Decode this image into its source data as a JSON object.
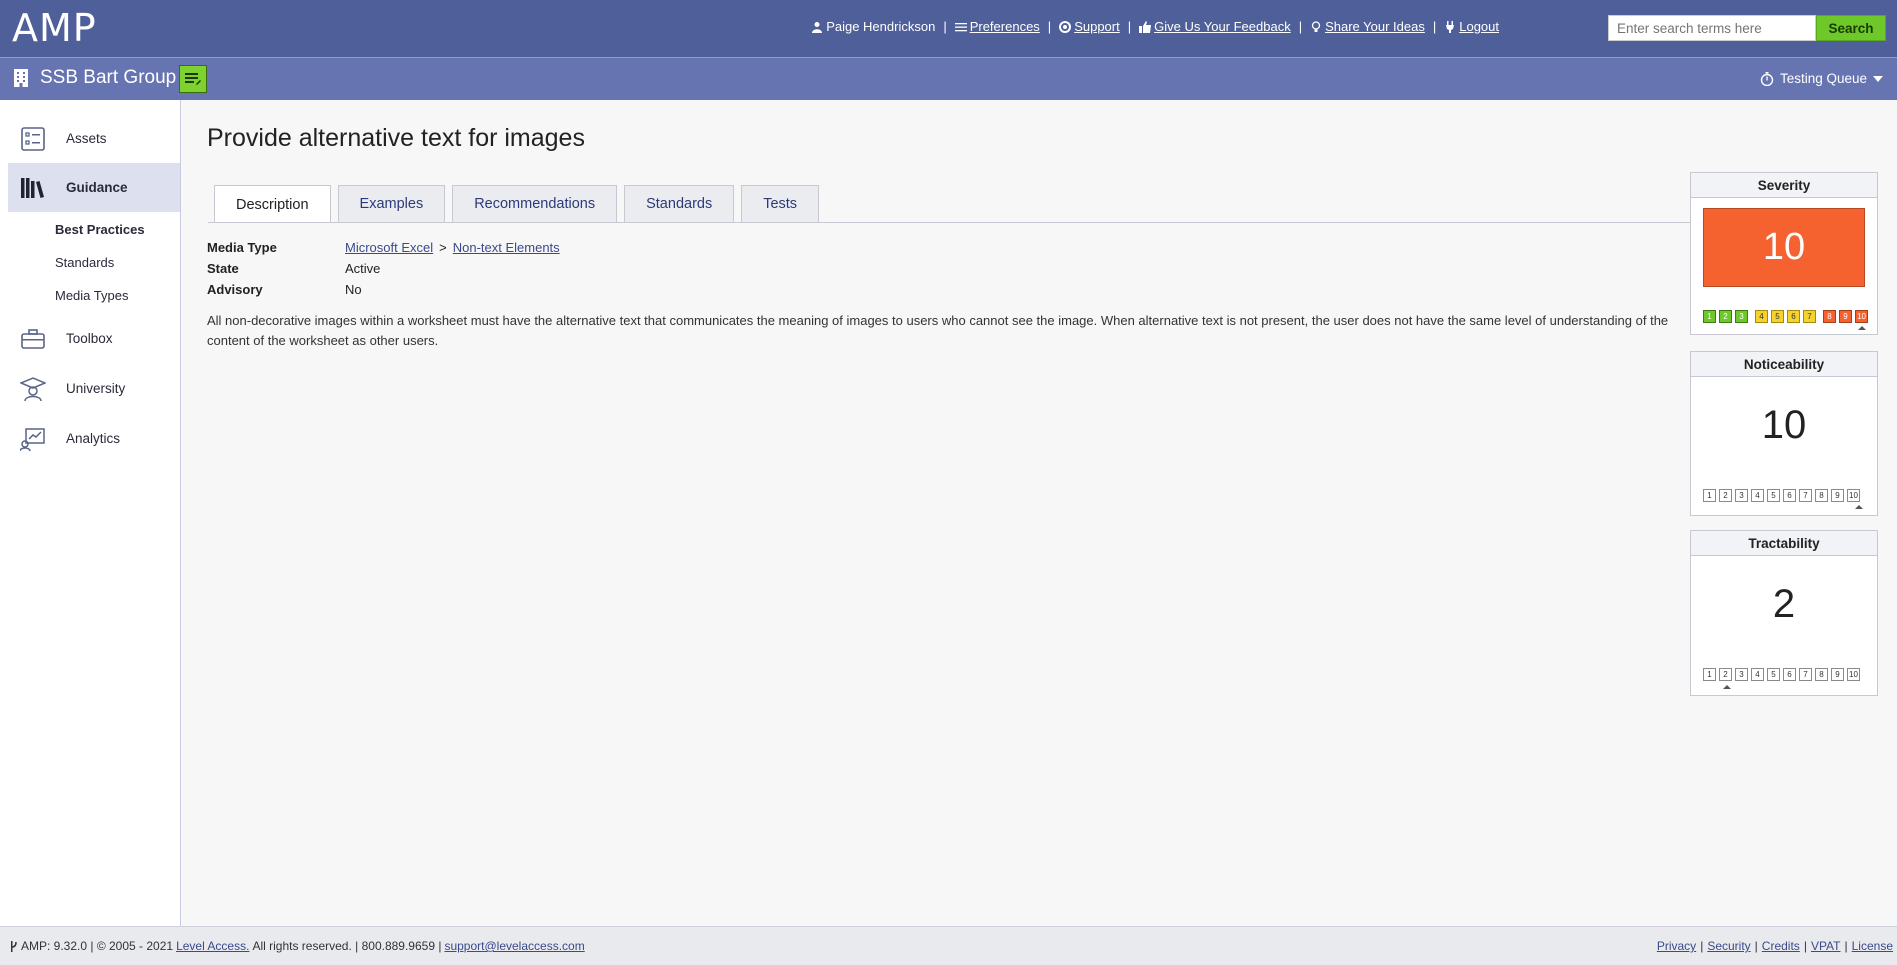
{
  "app": {
    "logo": "AMP"
  },
  "header": {
    "user": "Paige Hendrickson",
    "links": {
      "preferences": "Preferences",
      "support": "Support",
      "feedback": "Give Us Your Feedback",
      "ideas": "Share Your Ideas",
      "logout": "Logout"
    },
    "search_placeholder": "Enter search terms here",
    "search_label": "Search"
  },
  "org": {
    "name": "SSB Bart Group",
    "queue": "Testing Queue"
  },
  "sidebar": {
    "items": [
      {
        "label": "Assets",
        "icon": "assets-icon"
      },
      {
        "label": "Guidance",
        "icon": "guidance-icon"
      },
      {
        "label": "Toolbox",
        "icon": "toolbox-icon"
      },
      {
        "label": "University",
        "icon": "university-icon"
      },
      {
        "label": "Analytics",
        "icon": "analytics-icon"
      }
    ],
    "sub": [
      "Best Practices",
      "Standards",
      "Media Types"
    ]
  },
  "page": {
    "title": "Provide alternative text for images",
    "tabs": [
      "Description",
      "Examples",
      "Recommendations",
      "Standards",
      "Tests"
    ],
    "meta": {
      "media_type_label": "Media Type",
      "media_type_1": "Microsoft Excel",
      "media_type_sep": ">",
      "media_type_2": "Non-text Elements",
      "state_label": "State",
      "state_value": "Active",
      "advisory_label": "Advisory",
      "advisory_value": "No"
    },
    "description": "All non-decorative images within a worksheet must have the alternative text that communicates the meaning of images to users who cannot see the image. When alternative text is not present, the user does not have the same level of understanding of the content of the worksheet as other users."
  },
  "ratings": {
    "severity": {
      "label": "Severity",
      "value": "10"
    },
    "noticeability": {
      "label": "Noticeability",
      "value": "10"
    },
    "tractability": {
      "label": "Tractability",
      "value": "2"
    },
    "scale": [
      "1",
      "2",
      "3",
      "4",
      "5",
      "6",
      "7",
      "8",
      "9",
      "10"
    ],
    "colors": {
      "low": "#6fc829",
      "mid": "#f6d22e",
      "high": "#f6622f"
    }
  },
  "footer": {
    "version": "AMP: 9.32.0 | © 2005 - 2021",
    "company": "Level Access.",
    "rights": "All rights reserved. | 800.889.9659 |",
    "email": "support@levelaccess.com",
    "links": [
      "Privacy",
      "Security",
      "Credits",
      "VPAT",
      "License"
    ]
  }
}
